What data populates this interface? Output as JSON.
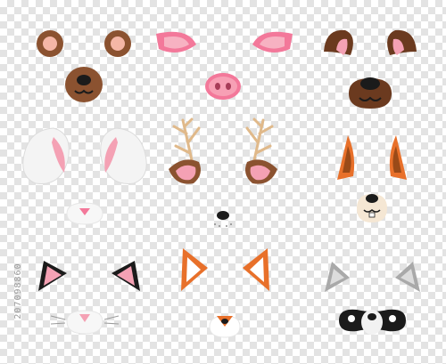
{
  "stock_id": "207098860",
  "masks": [
    {
      "animal": "bear"
    },
    {
      "animal": "pig"
    },
    {
      "animal": "dog"
    },
    {
      "animal": "rabbit"
    },
    {
      "animal": "deer"
    },
    {
      "animal": "squirrel"
    },
    {
      "animal": "cat"
    },
    {
      "animal": "fox"
    },
    {
      "animal": "raccoon"
    }
  ],
  "colors": {
    "brown": "#8b5230",
    "brown_dark": "#5a3219",
    "pink": "#f4a1b4",
    "pink_hot": "#f3789a",
    "orange": "#e8702a",
    "grey": "#a9a9a9",
    "black": "#1b1b1b"
  }
}
